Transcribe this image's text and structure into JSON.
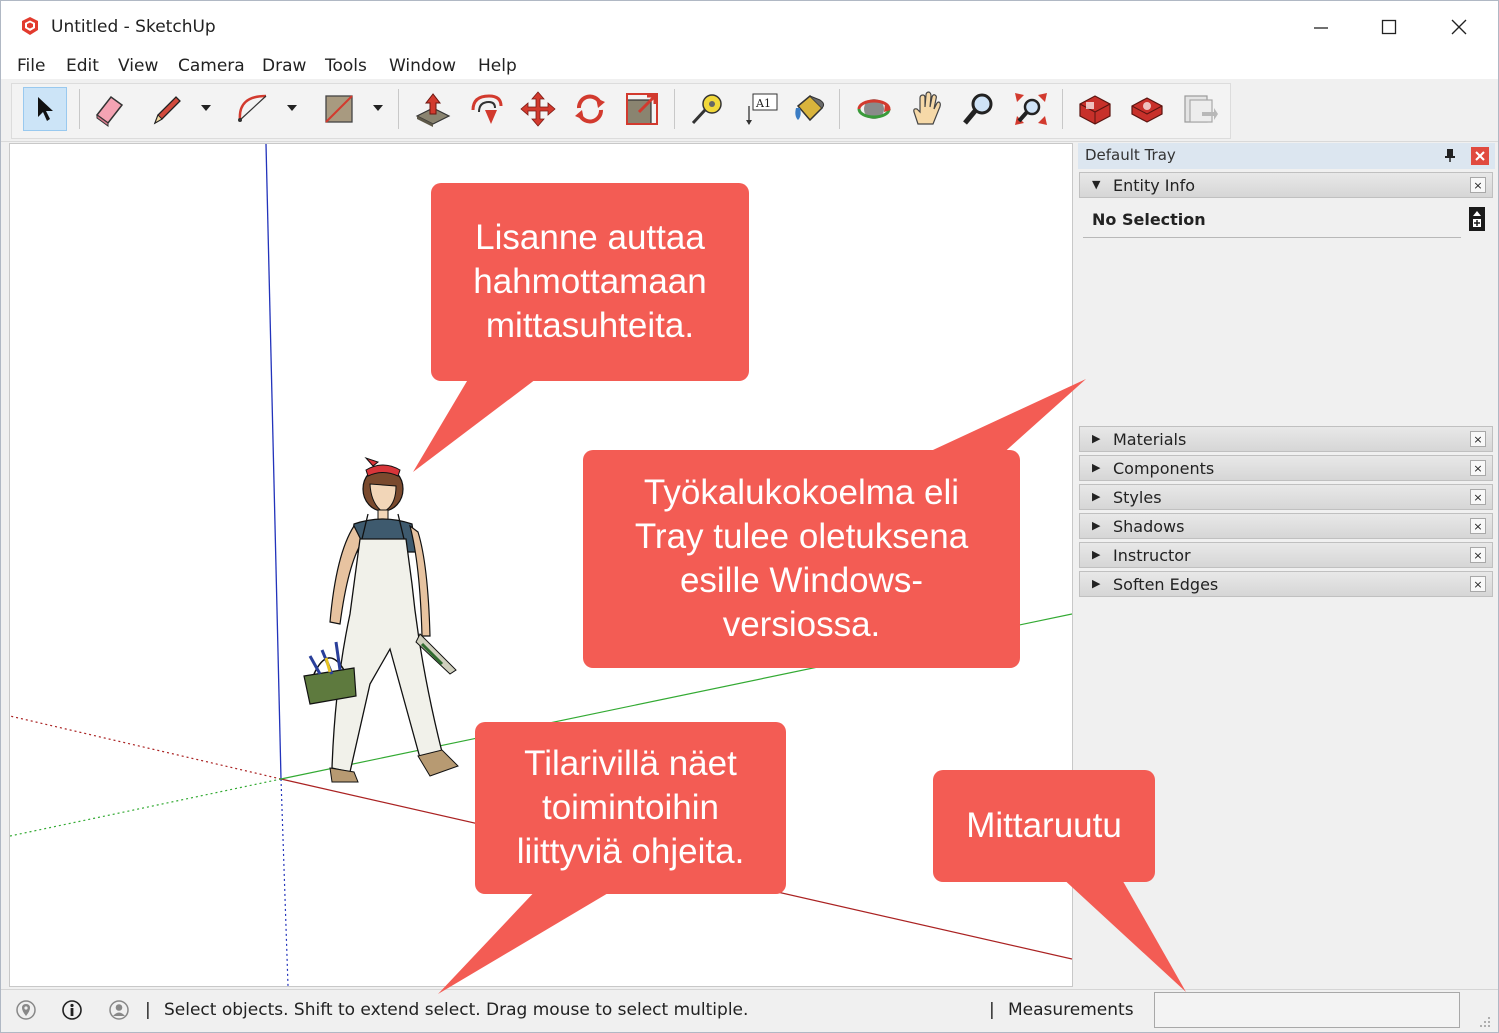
{
  "window": {
    "title": "Untitled - SketchUp",
    "controls": {
      "minimize": "—",
      "maximize": "☐",
      "close": "✕"
    }
  },
  "menu": [
    "File",
    "Edit",
    "View",
    "Camera",
    "Draw",
    "Tools",
    "Window",
    "Help"
  ],
  "toolbar": {
    "tools": [
      {
        "name": "select-tool",
        "icon": "arrow-cursor-icon",
        "selected": true
      },
      {
        "name": "eraser-tool",
        "icon": "eraser-icon"
      },
      {
        "name": "line-tool",
        "icon": "pencil-icon"
      },
      {
        "name": "arc-tool",
        "icon": "arc-icon"
      },
      {
        "name": "rectangle-tool",
        "icon": "rectangle-icon"
      },
      {
        "name": "push-pull-tool",
        "icon": "push-pull-icon"
      },
      {
        "name": "offset-tool",
        "icon": "offset-icon"
      },
      {
        "name": "move-tool",
        "icon": "move-arrows-icon"
      },
      {
        "name": "rotate-tool",
        "icon": "rotate-icon"
      },
      {
        "name": "scale-tool",
        "icon": "scale-icon"
      },
      {
        "name": "tape-measure-tool",
        "icon": "tape-measure-icon"
      },
      {
        "name": "text-tool",
        "icon": "text-label-icon",
        "text": "A1"
      },
      {
        "name": "paint-bucket-tool",
        "icon": "paint-bucket-icon"
      },
      {
        "name": "orbit-tool",
        "icon": "orbit-icon"
      },
      {
        "name": "pan-tool",
        "icon": "hand-icon"
      },
      {
        "name": "zoom-tool",
        "icon": "magnifier-icon"
      },
      {
        "name": "zoom-extents-tool",
        "icon": "zoom-extents-icon"
      },
      {
        "name": "3d-warehouse-tool",
        "icon": "warehouse-icon"
      },
      {
        "name": "extension-warehouse-tool",
        "icon": "extension-warehouse-icon"
      },
      {
        "name": "layout-tool",
        "icon": "layout-icon"
      }
    ]
  },
  "tray": {
    "title": "Default Tray",
    "entity_info": {
      "label": "Entity Info",
      "selection": "No Selection"
    },
    "panels": [
      "Materials",
      "Components",
      "Styles",
      "Shadows",
      "Instructor",
      "Soften Edges"
    ],
    "close_glyph": "×",
    "expanded_glyph": "▼",
    "collapsed_glyph": "▶"
  },
  "status": {
    "message": "Select objects. Shift to extend select. Drag mouse to select multiple.",
    "separator": "|",
    "measurements_label": "Measurements",
    "measurements_value": ""
  },
  "callouts": {
    "person": [
      "Lisanne auttaa",
      "hahmottamaan",
      "mittasuhteita."
    ],
    "tray": [
      "Työkalukokoelma eli",
      "Tray tulee oletuksena",
      "esille Windows-",
      "versiossa."
    ],
    "statusbar": [
      "Tilarivillä näet",
      "toimintoihin",
      "liittyviä ohjeita."
    ],
    "measurements": [
      "Mittaruutu"
    ]
  },
  "colors": {
    "callout": "#f35c54",
    "axis_blue": "#2233bb",
    "axis_red": "#aa2222",
    "axis_green": "#33aa33",
    "selected_tool": "#cce4f7",
    "tray_header": "#dce6f0"
  }
}
